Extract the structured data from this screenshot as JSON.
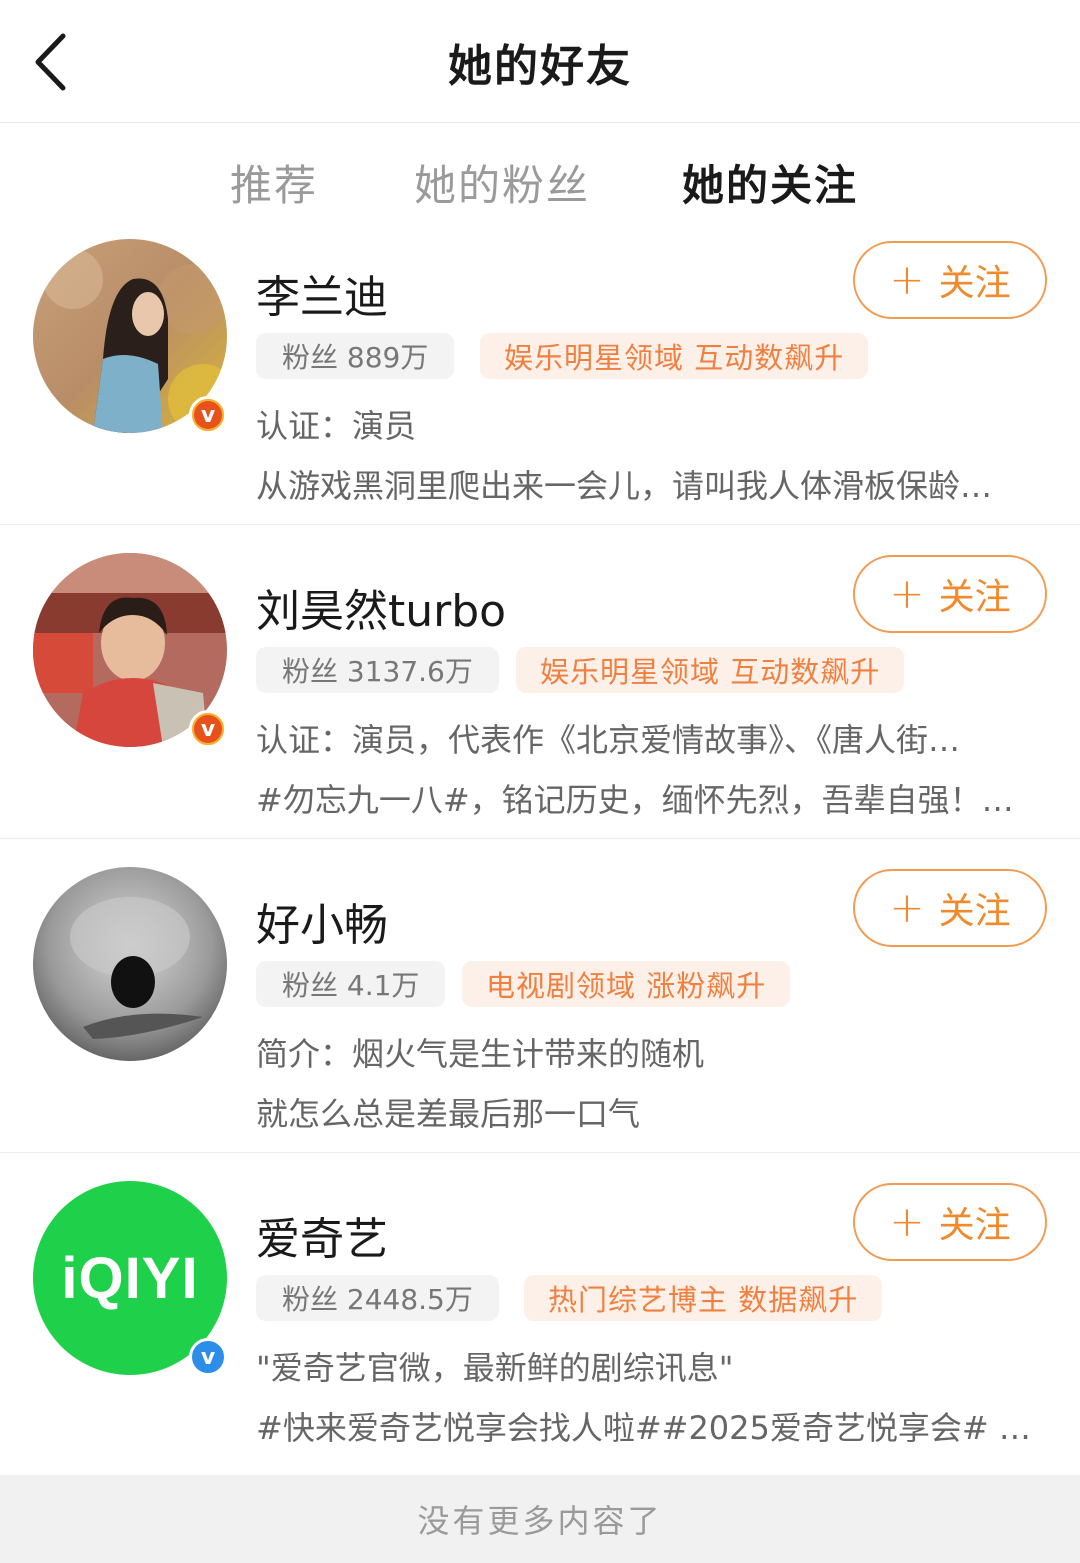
{
  "header": {
    "title": "她的好友"
  },
  "tabs": [
    {
      "label": "推荐"
    },
    {
      "label": "她的粉丝"
    },
    {
      "label": "她的关注"
    }
  ],
  "active_tab_color": "#ff3b1f",
  "follow_label": "关注",
  "users": [
    {
      "name": "李兰迪",
      "fans": "粉丝 889万",
      "tag": "娱乐明星领域 互动数飙升",
      "line1": "认证：演员",
      "line2": "从游戏黑洞里爬出来一会儿，请叫我人体滑板保龄…",
      "badge": "gold-v-icon"
    },
    {
      "name": "刘昊然turbo",
      "fans": "粉丝 3137.6万",
      "tag": "娱乐明星领域 互动数飙升",
      "line1": "认证：演员，代表作《北京爱情故事》、《唐人街…",
      "line2": "#勿忘九一八#，铭记历史，缅怀先烈，吾辈自强！…",
      "badge": "gold-v-icon"
    },
    {
      "name": "好小畅",
      "fans": "粉丝 4.1万",
      "tag": "电视剧领域 涨粉飙升",
      "line1": "简介：烟火气是生计带来的随机",
      "line2": "就怎么总是差最后那一口气",
      "badge": null
    },
    {
      "name": "爱奇艺",
      "fans": "粉丝 2448.5万",
      "tag": "热门综艺博主 数据飙升",
      "line1": "\"爱奇艺官微，最新鲜的剧综讯息\"",
      "line2": "#快来爱奇艺悦享会找人啦##2025爱奇艺悦享会# …",
      "badge": "blue-v-icon",
      "logo_text": "iQIYI"
    }
  ],
  "footer": {
    "text": "没有更多内容了"
  }
}
